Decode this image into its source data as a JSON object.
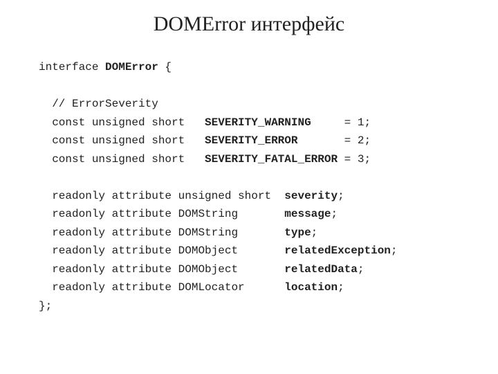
{
  "title": "DOMError интерфейс",
  "code": {
    "l1a": "interface ",
    "l1b": "DOMError",
    "l1c": " {",
    "l3": "  // ErrorSeverity",
    "l4a": "  const unsigned short   ",
    "l4b": "SEVERITY_WARNING",
    "l4c": "     = 1;",
    "l5a": "  const unsigned short   ",
    "l5b": "SEVERITY_ERROR",
    "l5c": "       = 2;",
    "l6a": "  const unsigned short   ",
    "l6b": "SEVERITY_FATAL_ERROR",
    "l6c": " = 3;",
    "l8a": "  readonly attribute unsigned short  ",
    "l8b": "severity",
    "l8c": ";",
    "l9a": "  readonly attribute DOMString       ",
    "l9b": "message",
    "l9c": ";",
    "l10a": "  readonly attribute DOMString       ",
    "l10b": "type",
    "l10c": ";",
    "l11a": "  readonly attribute DOMObject       ",
    "l11b": "relatedException",
    "l11c": ";",
    "l12a": "  readonly attribute DOMObject       ",
    "l12b": "relatedData",
    "l12c": ";",
    "l13a": "  readonly attribute DOMLocator      ",
    "l13b": "location",
    "l13c": ";",
    "l14": "};"
  }
}
